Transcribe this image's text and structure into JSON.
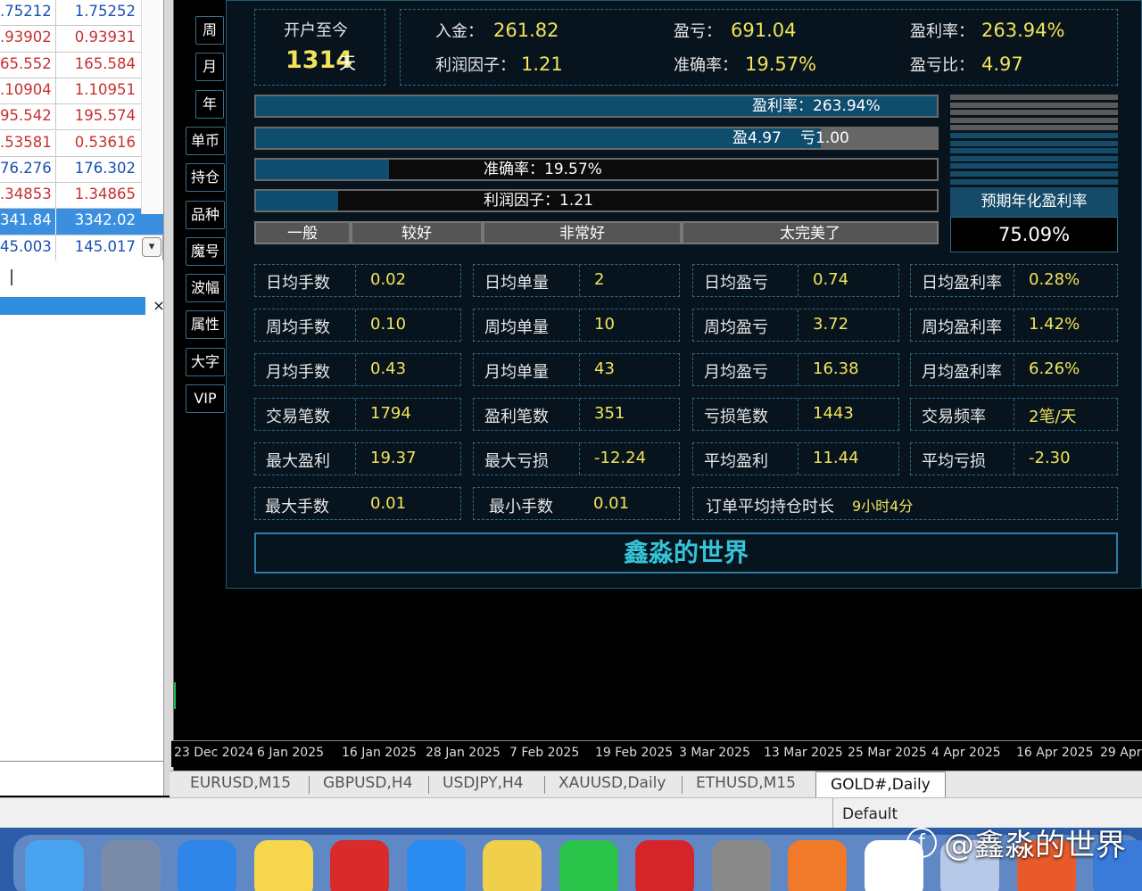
{
  "market_watch": {
    "rows": [
      {
        "bid": ".75212",
        "ask": "1.75252",
        "color": "blue"
      },
      {
        "bid": ".93902",
        "ask": "0.93931",
        "color": "red"
      },
      {
        "bid": "65.552",
        "ask": "165.584",
        "color": "red"
      },
      {
        "bid": ".10904",
        "ask": "1.10951",
        "color": "red"
      },
      {
        "bid": "95.542",
        "ask": "195.574",
        "color": "red"
      },
      {
        "bid": ".53581",
        "ask": "0.53616",
        "color": "red"
      },
      {
        "bid": "76.276",
        "ask": "176.302",
        "color": "blue"
      },
      {
        "bid": ".34853",
        "ask": "1.34865",
        "color": "red"
      },
      {
        "bid": "341.84",
        "ask": "3342.02",
        "color": "selected"
      },
      {
        "bid": "45.003",
        "ask": "145.017",
        "color": "blue"
      }
    ],
    "dropdown_icon": "chevron-down-icon",
    "close_label": "×"
  },
  "side_buttons": [
    "周",
    "月",
    "年",
    "单币",
    "持仓",
    "品种",
    "魔号",
    "波幅",
    "属性",
    "大字",
    "VIP"
  ],
  "summary": {
    "since_label": "开户至今",
    "days_value": "1314",
    "days_unit": "天",
    "deposit_label": "入金：",
    "deposit_value": "261.82",
    "pnl_label": "盈亏：",
    "pnl_value": "691.04",
    "profit_rate_label": "盈利率：",
    "profit_rate_value": "263.94%",
    "profit_factor_label": "利润因子：",
    "profit_factor_value": "1.21",
    "accuracy_label": "准确率：",
    "accuracy_value": "19.57%",
    "pl_ratio_label": "盈亏比：",
    "pl_ratio_value": "4.97"
  },
  "bars": {
    "profit_rate_text": "盈利率：263.94%",
    "profit_rate_fill": 1.0,
    "win_text": "盈4.97",
    "loss_text": "亏1.00",
    "win_fill": 0.83,
    "accuracy_text": "准确率：19.57%",
    "accuracy_fill": 0.1957,
    "profit_factor_text": "利润因子：1.21",
    "profit_factor_fill": 0.121,
    "rating": [
      "一般",
      "较好",
      "非常好",
      "太完美了"
    ]
  },
  "annual": {
    "label": "预期年化盈利率",
    "value": "75.09%",
    "level": 0.6
  },
  "stats": [
    [
      {
        "label": "日均手数",
        "value": "0.02"
      },
      {
        "label": "日均单量",
        "value": "2"
      },
      {
        "label": "日均盈亏",
        "value": "0.74"
      },
      {
        "label": "日均盈利率",
        "value": "0.28%"
      }
    ],
    [
      {
        "label": "周均手数",
        "value": "0.10"
      },
      {
        "label": "周均单量",
        "value": "10"
      },
      {
        "label": "周均盈亏",
        "value": "3.72"
      },
      {
        "label": "周均盈利率",
        "value": "1.42%"
      }
    ],
    [
      {
        "label": "月均手数",
        "value": "0.43"
      },
      {
        "label": "月均单量",
        "value": "43"
      },
      {
        "label": "月均盈亏",
        "value": "16.38"
      },
      {
        "label": "月均盈利率",
        "value": "6.26%"
      }
    ],
    [
      {
        "label": "交易笔数",
        "value": "1794"
      },
      {
        "label": "盈利笔数",
        "value": "351"
      },
      {
        "label": "亏损笔数",
        "value": "1443"
      },
      {
        "label": "交易频率",
        "value": "2笔/天"
      }
    ],
    [
      {
        "label": "最大盈利",
        "value": "19.37"
      },
      {
        "label": "最大亏损",
        "value": "-12.24"
      },
      {
        "label": "平均盈利",
        "value": "11.44"
      },
      {
        "label": "平均亏损",
        "value": "-2.30"
      }
    ]
  ],
  "last_row": {
    "max_lots_label": "最大手数",
    "max_lots_value": "0.01",
    "min_lots_label": "最小手数",
    "min_lots_value": "0.01",
    "avg_hold_label": "订单平均持仓时长",
    "avg_hold_value": "9小时4分"
  },
  "banner": "鑫淼的世界",
  "x_axis": [
    "23 Dec 2024",
    "6 Jan 2025",
    "16 Jan 2025",
    "28 Jan 2025",
    "7 Feb 2025",
    "19 Feb 2025",
    "3 Mar 2025",
    "13 Mar 2025",
    "25 Mar 2025",
    "4 Apr 2025",
    "16 Apr 2025",
    "29 Apr"
  ],
  "chart_tabs": [
    "EURUSD,M15",
    "GBPUSD,H4",
    "USDJPY,H4",
    "XAUUSD,Daily",
    "ETHUSD,M15",
    "GOLD#,Daily"
  ],
  "status_default": "Default",
  "watermark": "@鑫淼的世界",
  "dock_icons": [
    "finder-icon",
    "launchpad-icon",
    "safari-icon",
    "notes-icon",
    "tonghuashun-icon",
    "app-store-icon",
    "stickies-icon",
    "wechat-icon",
    "netease-music-icon",
    "system-settings-icon",
    "video-player-icon",
    "chatgpt-icon",
    "rocket-icon",
    "remote-desktop-icon",
    "window-icon"
  ]
}
